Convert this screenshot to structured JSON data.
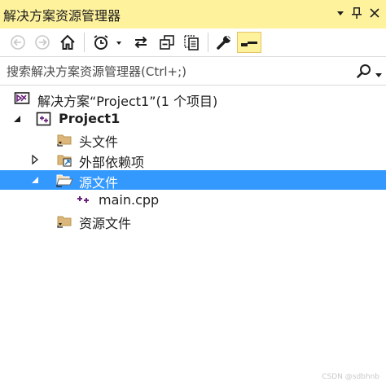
{
  "window": {
    "title": "解决方案资源管理器",
    "menu_glyph": "▾",
    "pin_glyph": "ᛘ",
    "close_glyph": "✕"
  },
  "toolbar": {
    "buttons": [
      {
        "name": "back-button",
        "icon": "back-arrow-icon"
      },
      {
        "name": "forward-button",
        "icon": "forward-arrow-icon"
      },
      {
        "name": "home-button",
        "icon": "home-icon"
      },
      {
        "name": "pending-changes-filter-button",
        "icon": "clock-filter-icon"
      },
      {
        "name": "sync-with-active-document-button",
        "icon": "sync-arrows-icon"
      },
      {
        "name": "collapse-all-button",
        "icon": "collapse-all-icon"
      },
      {
        "name": "show-all-files-button",
        "icon": "show-all-files-icon"
      },
      {
        "name": "properties-button",
        "icon": "wrench-icon"
      },
      {
        "name": "preview-selected-items-button",
        "icon": "preview-icon",
        "active": true
      }
    ],
    "active_color": "#fff29d"
  },
  "search": {
    "placeholder": "搜索解决方案资源管理器(Ctrl+;)"
  },
  "tree": {
    "solution": {
      "label": "解决方案“Project1”(1 个项目)"
    },
    "project": {
      "label": "Project1",
      "expanded": true
    },
    "items": [
      {
        "label": "头文件",
        "icon": "filter-folder-icon"
      },
      {
        "label": "外部依赖项",
        "icon": "external-deps-icon",
        "expanded": false
      },
      {
        "label": "源文件",
        "icon": "filter-folder-open-icon",
        "expanded": true,
        "selected": true
      },
      {
        "label": "main.cpp",
        "icon": "cpp-file-icon"
      },
      {
        "label": "资源文件",
        "icon": "filter-folder-icon"
      }
    ],
    "selection_color": "#3399ff"
  },
  "watermark": "CSDN @sdbhnb"
}
